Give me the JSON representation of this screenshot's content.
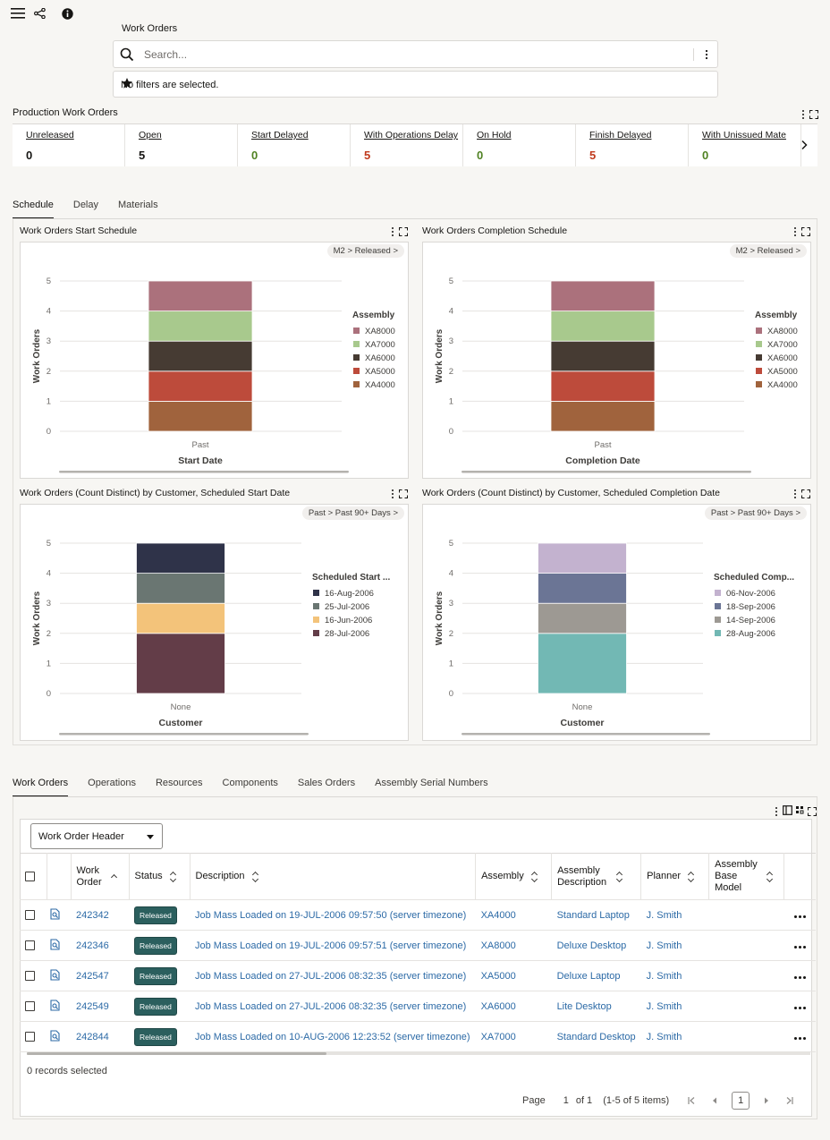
{
  "header": {
    "menu_icon": "hamburger-icon",
    "share_icon": "share-icon",
    "info_icon": "info-icon",
    "page_title": "Work Orders"
  },
  "search": {
    "placeholder": "Search...",
    "filter_text": "No filters are selected."
  },
  "production": {
    "title": "Production Work Orders",
    "tiles": [
      {
        "label": "Unreleased",
        "value": "0",
        "color": "#161513"
      },
      {
        "label": "Open",
        "value": "5",
        "color": "#161513"
      },
      {
        "label": "Start Delayed",
        "value": "0",
        "color": "#508223"
      },
      {
        "label": "With Operations Delay",
        "value": "5",
        "color": "#c03a1d"
      },
      {
        "label": "On Hold",
        "value": "0",
        "color": "#508223"
      },
      {
        "label": "Finish Delayed",
        "value": "5",
        "color": "#c03a1d"
      },
      {
        "label": "With Unissued Mate",
        "value": "0",
        "color": "#508223"
      }
    ]
  },
  "chart_tabs": [
    "Schedule",
    "Delay",
    "Materials"
  ],
  "chart_data": [
    {
      "title": "Work Orders Start Schedule",
      "breadcrumb": "M2 > Released >",
      "type": "bar",
      "stacked": true,
      "categories": [
        "Past"
      ],
      "xlabel": "Start Date",
      "ylabel": "Work Orders",
      "ylim": [
        0,
        5
      ],
      "yticks": [
        "0",
        "1",
        "2",
        "3",
        "4",
        "5"
      ],
      "legend_title": "Assembly",
      "legend_position": "right",
      "series": [
        {
          "name": "XA4000",
          "color": "#a0633d",
          "values": [
            1
          ]
        },
        {
          "name": "XA5000",
          "color": "#bd4b3b",
          "values": [
            1
          ]
        },
        {
          "name": "XA6000",
          "color": "#463b33",
          "values": [
            1
          ]
        },
        {
          "name": "XA7000",
          "color": "#a8c98d",
          "values": [
            1
          ]
        },
        {
          "name": "XA8000",
          "color": "#ab717c",
          "values": [
            1
          ]
        }
      ]
    },
    {
      "title": "Work Orders Completion Schedule",
      "breadcrumb": "M2 > Released >",
      "type": "bar",
      "stacked": true,
      "categories": [
        "Past"
      ],
      "xlabel": "Completion Date",
      "ylabel": "Work Orders",
      "ylim": [
        0,
        5
      ],
      "yticks": [
        "0",
        "1",
        "2",
        "3",
        "4",
        "5"
      ],
      "legend_title": "Assembly",
      "legend_position": "right",
      "series": [
        {
          "name": "XA4000",
          "color": "#a0633d",
          "values": [
            1
          ]
        },
        {
          "name": "XA5000",
          "color": "#bd4b3b",
          "values": [
            1
          ]
        },
        {
          "name": "XA6000",
          "color": "#463b33",
          "values": [
            1
          ]
        },
        {
          "name": "XA7000",
          "color": "#a8c98d",
          "values": [
            1
          ]
        },
        {
          "name": "XA8000",
          "color": "#ab717c",
          "values": [
            1
          ]
        }
      ]
    },
    {
      "title": "Work Orders (Count Distinct) by Customer, Scheduled Start Date",
      "breadcrumb": "Past > Past 90+ Days >",
      "type": "bar",
      "stacked": true,
      "categories": [
        "None"
      ],
      "xlabel": "Customer",
      "ylabel": "Work Orders",
      "ylim": [
        0,
        5
      ],
      "yticks": [
        "0",
        "1",
        "2",
        "3",
        "4",
        "5"
      ],
      "legend_title": "Scheduled Start ...",
      "legend_position": "right",
      "series": [
        {
          "name": "28-Jul-2006",
          "color": "#633d48",
          "values": [
            2
          ]
        },
        {
          "name": "16-Jun-2006",
          "color": "#f3c37a",
          "values": [
            1
          ]
        },
        {
          "name": "25-Jul-2006",
          "color": "#6a7672",
          "values": [
            1
          ]
        },
        {
          "name": "16-Aug-2006",
          "color": "#2f3349",
          "values": [
            1
          ]
        }
      ]
    },
    {
      "title": "Work Orders (Count Distinct) by Customer, Scheduled Completion Date",
      "breadcrumb": "Past > Past 90+ Days >",
      "type": "bar",
      "stacked": true,
      "categories": [
        "None"
      ],
      "xlabel": "Customer",
      "ylabel": "Work Orders",
      "ylim": [
        0,
        5
      ],
      "yticks": [
        "0",
        "1",
        "2",
        "3",
        "4",
        "5"
      ],
      "legend_title": "Scheduled Comp...",
      "legend_position": "right",
      "series": [
        {
          "name": "28-Aug-2006",
          "color": "#72b8b4",
          "values": [
            2
          ]
        },
        {
          "name": "14-Sep-2006",
          "color": "#9d9993",
          "values": [
            1
          ]
        },
        {
          "name": "18-Sep-2006",
          "color": "#6b7595",
          "values": [
            1
          ]
        },
        {
          "name": "06-Nov-2006",
          "color": "#c3b2cf",
          "values": [
            1
          ]
        }
      ]
    }
  ],
  "bottom_tabs": [
    "Work Orders",
    "Operations",
    "Resources",
    "Components",
    "Sales Orders",
    "Assembly Serial Numbers"
  ],
  "table": {
    "view_select": "Work Order Header",
    "columns": [
      "Work Order",
      "Status",
      "Description",
      "Assembly",
      "Assembly Description",
      "Planner",
      "Assembly Base Model"
    ],
    "rows": [
      {
        "work_order": "242342",
        "status": "Released",
        "description": "Job Mass Loaded on 19-JUL-2006 09:57:50 (server timezone)",
        "assembly": "XA4000",
        "assembly_description": "Standard Laptop",
        "planner": "J. Smith",
        "base_model": ""
      },
      {
        "work_order": "242346",
        "status": "Released",
        "description": "Job Mass Loaded on 19-JUL-2006 09:57:51 (server timezone)",
        "assembly": "XA8000",
        "assembly_description": "Deluxe Desktop",
        "planner": "J. Smith",
        "base_model": ""
      },
      {
        "work_order": "242547",
        "status": "Released",
        "description": "Job Mass Loaded on 27-JUL-2006 08:32:35 (server timezone)",
        "assembly": "XA5000",
        "assembly_description": "Deluxe Laptop",
        "planner": "J. Smith",
        "base_model": ""
      },
      {
        "work_order": "242549",
        "status": "Released",
        "description": "Job Mass Loaded on 27-JUL-2006 08:32:35 (server timezone)",
        "assembly": "XA6000",
        "assembly_description": "Lite Desktop",
        "planner": "J. Smith",
        "base_model": ""
      },
      {
        "work_order": "242844",
        "status": "Released",
        "description": "Job Mass Loaded on 10-AUG-2006 12:23:52 (server timezone)",
        "assembly": "XA7000",
        "assembly_description": "Standard Desktop",
        "planner": "J. Smith",
        "base_model": ""
      }
    ],
    "records_selected": "0 records selected",
    "pager": {
      "page_label": "Page",
      "page": "1",
      "of": "of 1",
      "items": "(1-5 of 5 items)"
    }
  }
}
